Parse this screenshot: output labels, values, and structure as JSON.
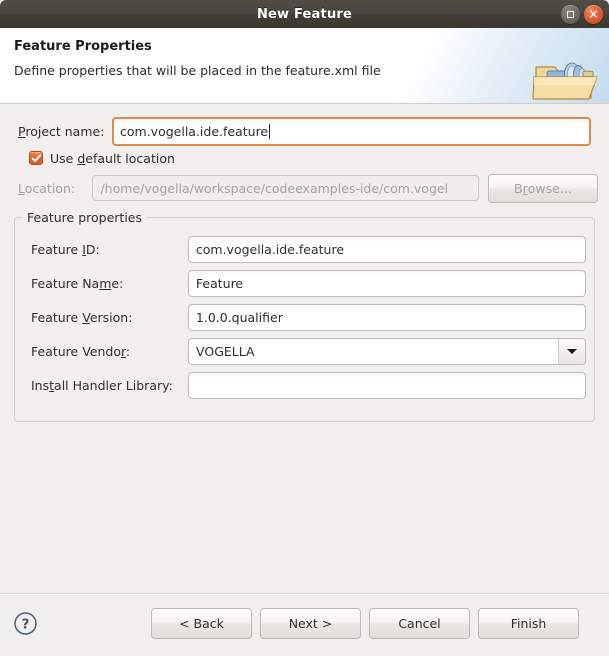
{
  "window": {
    "title": "New Feature",
    "maximize_label": "Maximize",
    "close_label": "Close"
  },
  "header": {
    "title": "Feature Properties",
    "description": "Define properties that will be placed in the feature.xml file",
    "icon": "feature-folder-icon"
  },
  "project": {
    "label_pre": "",
    "label_mnemonic": "P",
    "label_post": "roject name:",
    "label_full": "Project name:",
    "value": "com.vogella.ide.feature"
  },
  "use_default_location": {
    "label_pre": "Use ",
    "label_mnemonic": "d",
    "label_post": "efault location",
    "label_full": "Use default location",
    "checked": true
  },
  "location": {
    "label_pre": "",
    "label_mnemonic": "L",
    "label_post": "ocation:",
    "label_full": "Location:",
    "value": "/home/vogella/workspace/codeexamples-ide/com.vogel",
    "disabled": true
  },
  "browse": {
    "label_pre": "B",
    "label_mnemonic": "r",
    "label_post": "owse...",
    "label_full": "Browse...",
    "disabled": true
  },
  "feature_properties": {
    "group_title": "Feature properties",
    "rows": [
      {
        "label_pre": "Feature ",
        "label_mnemonic": "I",
        "label_post": "D:",
        "label_full": "Feature ID:",
        "value": "com.vogella.ide.feature",
        "type": "text"
      },
      {
        "label_pre": "Feature Na",
        "label_mnemonic": "m",
        "label_post": "e:",
        "label_full": "Feature Name:",
        "value": "Feature",
        "type": "text"
      },
      {
        "label_pre": "Feature ",
        "label_mnemonic": "V",
        "label_post": "ersion:",
        "label_full": "Feature Version:",
        "value": "1.0.0.qualifier",
        "type": "text"
      },
      {
        "label_pre": "Feature Vendo",
        "label_mnemonic": "r",
        "label_post": ":",
        "label_full": "Feature Vendor:",
        "value": "VOGELLA",
        "type": "combo"
      },
      {
        "label_pre": "Ins",
        "label_mnemonic": "t",
        "label_post": "all Handler Library:",
        "label_full": "Install Handler Library:",
        "value": "",
        "type": "text"
      }
    ]
  },
  "footer": {
    "help_label": "Help",
    "buttons": [
      {
        "label": "< Back",
        "name": "back-button",
        "disabled": false
      },
      {
        "label": "Next >",
        "name": "next-button",
        "disabled": false
      },
      {
        "label": "Cancel",
        "name": "cancel-button",
        "disabled": false
      },
      {
        "label": "Finish",
        "name": "finish-button",
        "disabled": false
      }
    ]
  },
  "colors": {
    "titlebar": "#4a4640",
    "accent_orange": "#dd6a2c",
    "focus_border": "#e08b4e",
    "body_bg": "#f0efed",
    "close_button": "#df5d32"
  }
}
